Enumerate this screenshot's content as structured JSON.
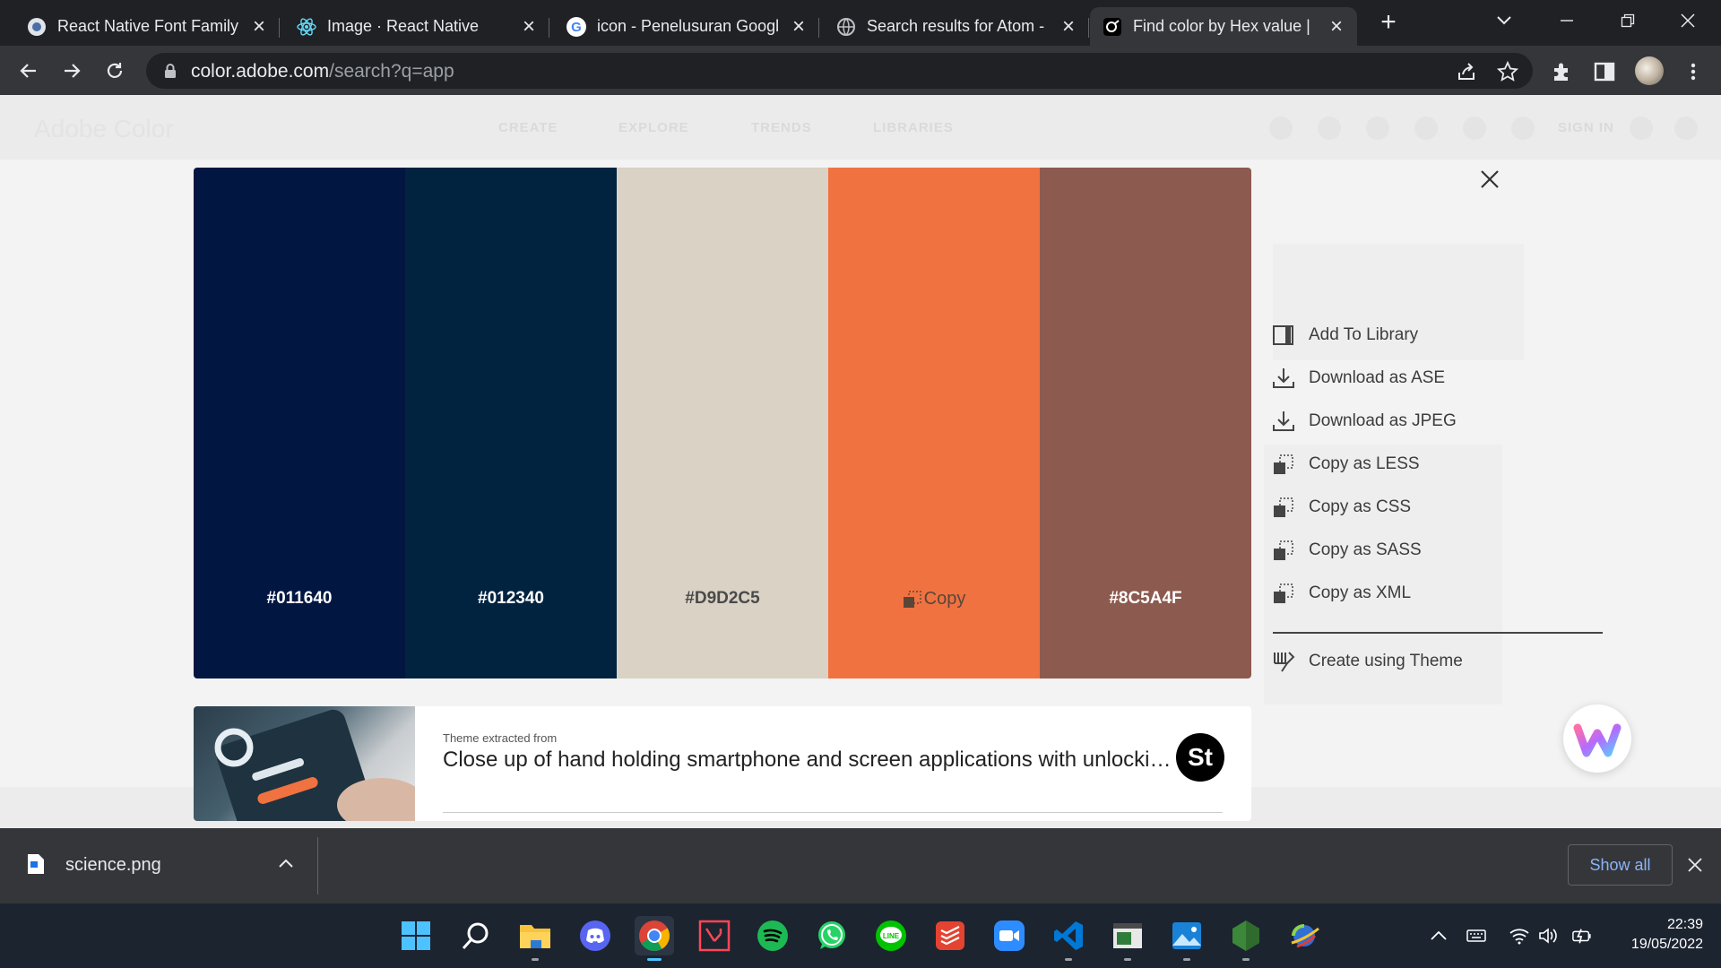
{
  "browser": {
    "tabs": [
      {
        "title": "React Native Font Family",
        "icon": "react-native-font-favicon-icon"
      },
      {
        "title": "Image · React Native",
        "icon": "react-favicon-icon"
      },
      {
        "title": "icon - Penelusuran Googl",
        "icon": "google-favicon-icon"
      },
      {
        "title": "Search results for Atom -",
        "icon": "globe-favicon-icon"
      },
      {
        "title": "Find color by Hex value | ",
        "icon": "adobe-color-favicon-icon",
        "active": true
      }
    ],
    "url_host": "color.adobe.com",
    "url_path": "/search?q=app"
  },
  "page": {
    "site_logo": "Adobe Color",
    "nav": [
      "CREATE",
      "EXPLORE",
      "TRENDS",
      "LIBRARIES"
    ],
    "sign_in": "SIGN IN",
    "swatches": [
      {
        "hex": "#011640",
        "color": "#011640",
        "label_color": "#ffffff"
      },
      {
        "hex": "#012340",
        "color": "#012340",
        "label_color": "#ffffff"
      },
      {
        "hex": "#D9D2C5",
        "color": "#D9D2C5",
        "label_color": "#4a4a4a"
      },
      {
        "hex": "",
        "color": "#F07240",
        "label_color": "#5a4637",
        "copy_label": "Copy",
        "hovered": true
      },
      {
        "hex": "#8C5A4F",
        "color": "#8C5A4F",
        "label_color": "#ffffff"
      }
    ],
    "actions": [
      {
        "label": "Add To Library",
        "icon": "library-icon"
      },
      {
        "label": "Download as ASE",
        "icon": "download-icon"
      },
      {
        "label": "Download as JPEG",
        "icon": "download-icon"
      },
      {
        "label": "Copy as LESS",
        "icon": "copy-icon"
      },
      {
        "label": "Copy as CSS",
        "icon": "copy-icon"
      },
      {
        "label": "Copy as SASS",
        "icon": "copy-icon"
      },
      {
        "label": "Copy as XML",
        "icon": "copy-icon"
      }
    ],
    "create_theme": "Create using Theme",
    "source": {
      "label": "Theme extracted from",
      "title": "Close up of hand holding smartphone and screen applications with unlocking...",
      "badge": "St"
    }
  },
  "downloads": {
    "filename": "science.png",
    "show_all": "Show all"
  },
  "taskbar": {
    "apps": [
      "start-icon",
      "search-icon",
      "file-explorer-icon",
      "discord-icon",
      "chrome-icon",
      "valorant-icon",
      "spotify-icon",
      "whatsapp-icon",
      "line-icon",
      "todoist-icon",
      "zoom-icon",
      "vscode-icon",
      "terminal-app-icon",
      "photos-icon",
      "nodejs-icon",
      "network-app-icon"
    ],
    "active_app": "chrome-icon",
    "time": "22:39",
    "date": "19/05/2022"
  }
}
